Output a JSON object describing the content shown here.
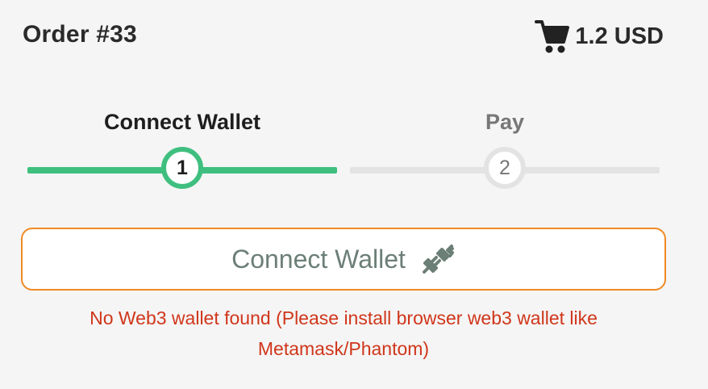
{
  "header": {
    "order_title": "Order #33",
    "cart_total": "1.2 USD",
    "cart_icon": "shopping-cart-icon"
  },
  "stepper": {
    "steps": [
      {
        "label": "Connect Wallet",
        "number": "1",
        "state": "active"
      },
      {
        "label": "Pay",
        "number": "2",
        "state": "inactive"
      }
    ],
    "active_color": "#3fbf7f",
    "inactive_color": "#e3e3e3"
  },
  "connect_button": {
    "label": "Connect Wallet",
    "icon": "plug-icon",
    "border_color": "#f08a24"
  },
  "error": {
    "message": "No Web3 wallet found (Please install browser web3 wallet like Metamask/Phantom)",
    "color": "#d0361a"
  }
}
